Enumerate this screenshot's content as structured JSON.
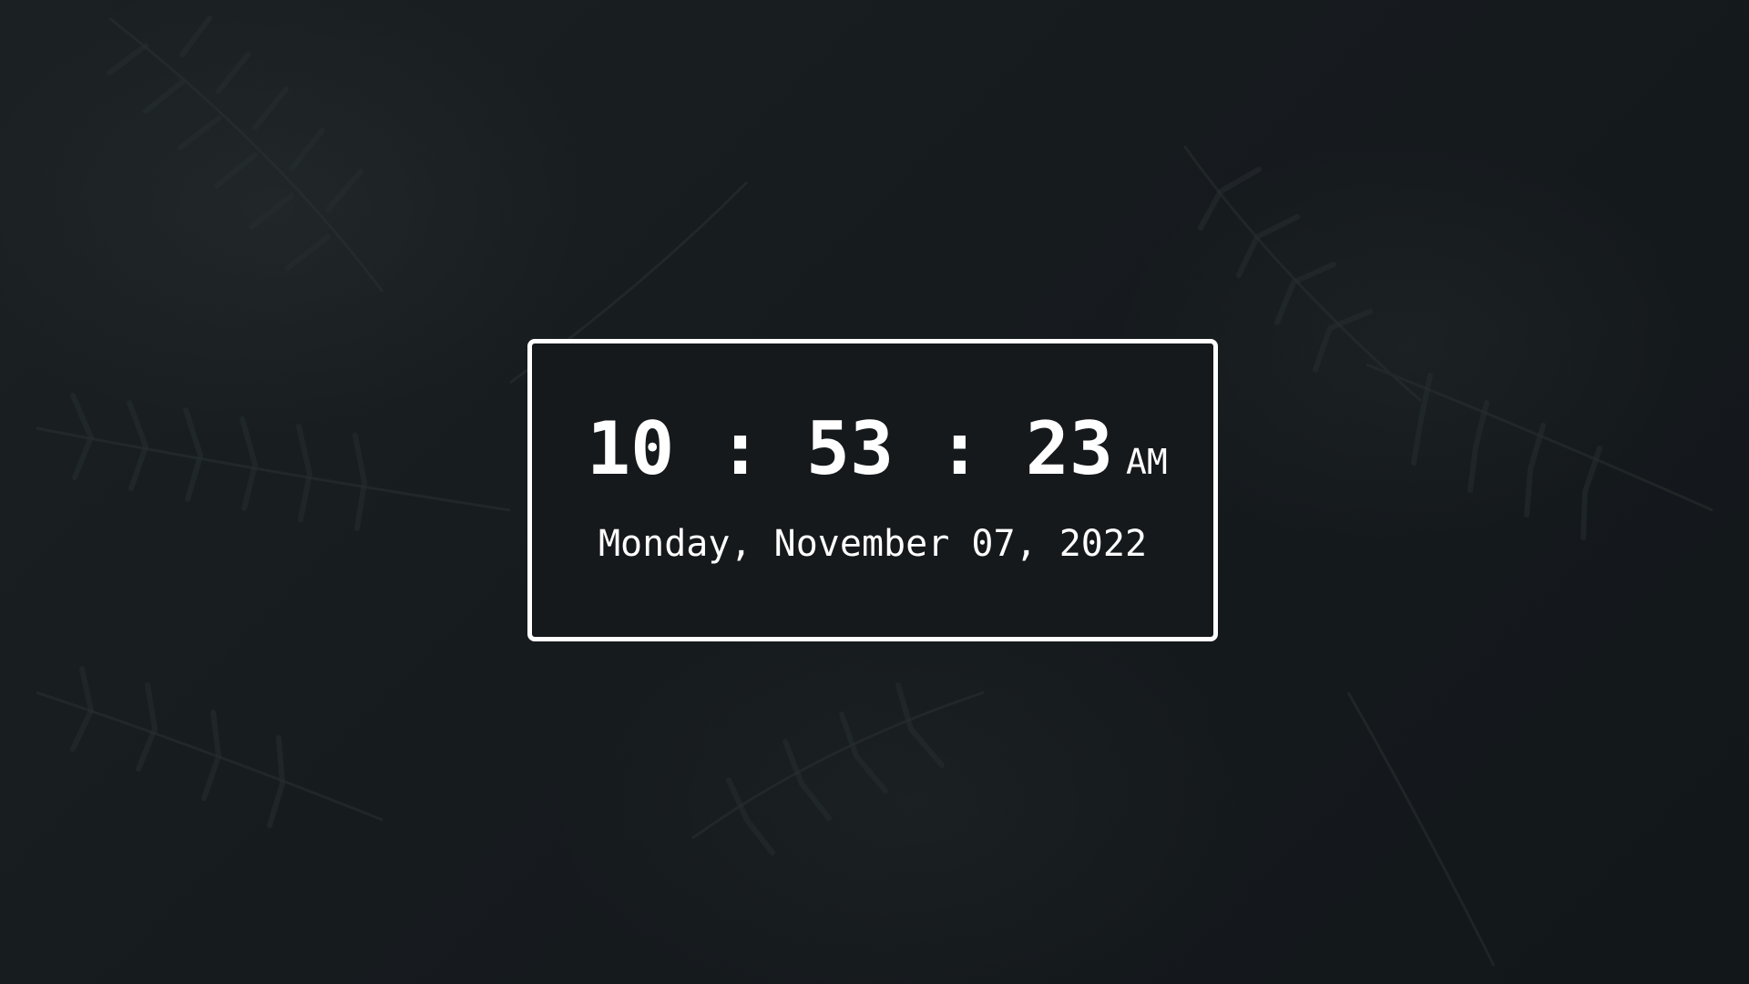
{
  "clock": {
    "hours": "10",
    "separator": ":",
    "minutes": "53",
    "seconds": "23",
    "meridiem": "AM",
    "date": "Monday, November 07, 2022"
  },
  "background": {
    "image": "fern-leaves-icon",
    "base_color": "#151a1d"
  },
  "card": {
    "border_color": "#ffffff",
    "background_color": "#15191c",
    "text_color": "#ffffff"
  }
}
